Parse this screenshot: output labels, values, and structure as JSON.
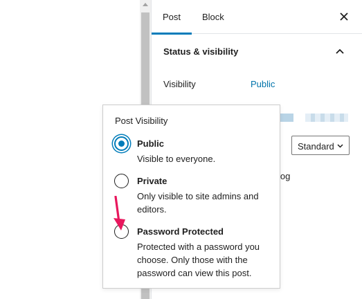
{
  "sidebar": {
    "tabs": [
      {
        "label": "Post",
        "active": true
      },
      {
        "label": "Block",
        "active": false
      }
    ],
    "close_icon": "close-icon",
    "panel": {
      "title": "Status & visibility",
      "expanded_icon": "chevron-up-icon",
      "visibility_label": "Visibility",
      "visibility_value": "Public",
      "template_select": "Standard",
      "partial_text": "log"
    }
  },
  "popover": {
    "title": "Post Visibility",
    "options": [
      {
        "label": "Public",
        "description": "Visible to everyone.",
        "checked": true
      },
      {
        "label": "Private",
        "description": "Only visible to site admins and editors.",
        "checked": false
      },
      {
        "label": "Password Protected",
        "description": "Protected with a password you choose. Only those with the password can view this post.",
        "checked": false
      }
    ]
  },
  "annotation": {
    "icon": "arrow-pointer-icon",
    "color": "#e8175d"
  },
  "colors": {
    "accent": "#007cba",
    "link": "#0073aa"
  }
}
